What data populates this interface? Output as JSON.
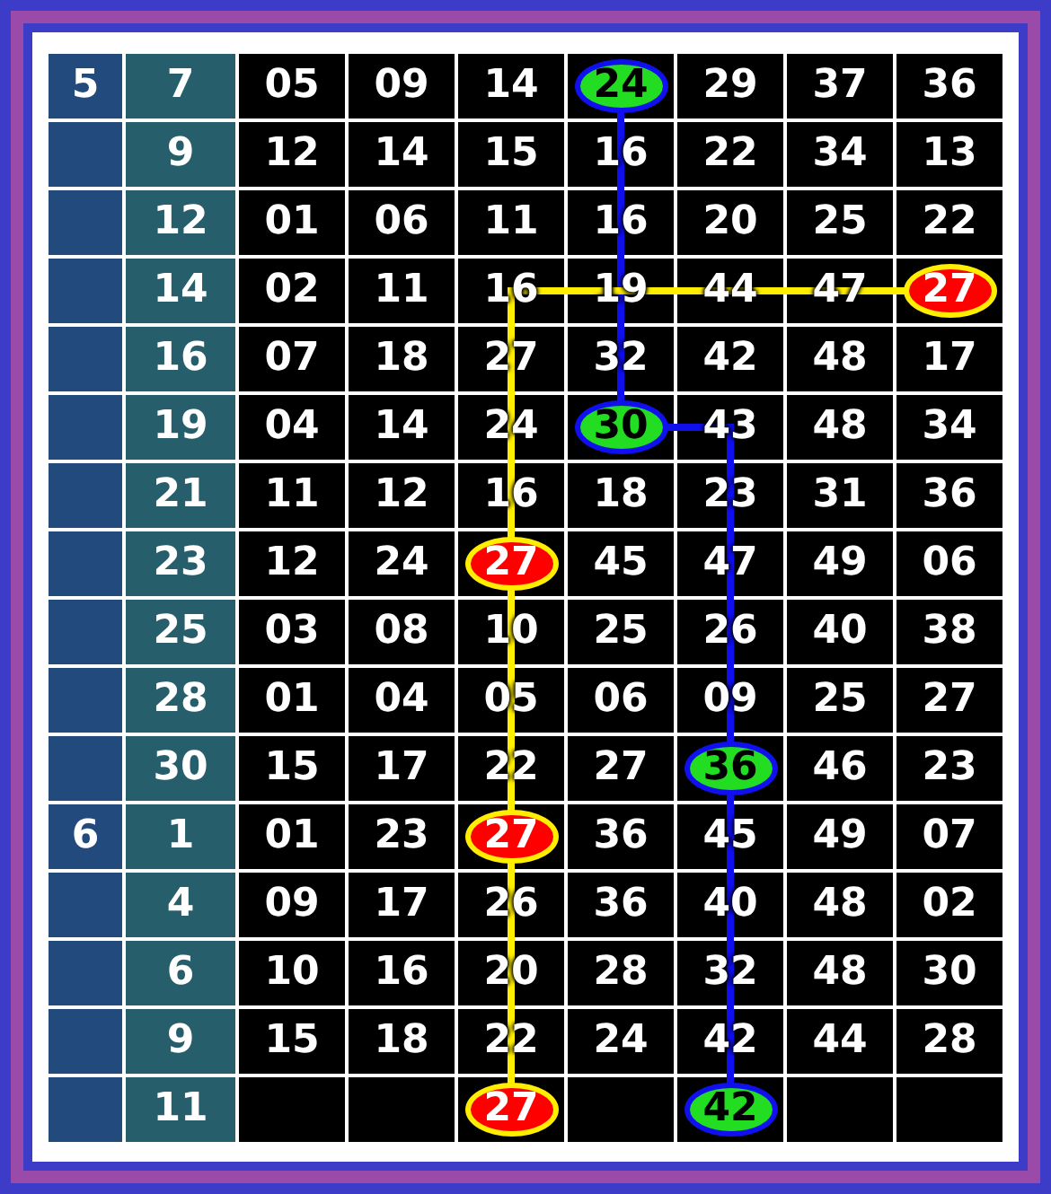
{
  "rows": [
    {
      "month": "5",
      "day": "7",
      "cells": [
        {
          "text": "05"
        },
        {
          "text": "09"
        },
        {
          "text": "14"
        },
        {
          "text": "24",
          "color": "#22dd22"
        },
        {
          "text": "29"
        },
        {
          "text": "37"
        },
        {
          "text": "36"
        }
      ]
    },
    {
      "day": "9",
      "cells": [
        {
          "text": "12"
        },
        {
          "text": "14"
        },
        {
          "text": "15"
        },
        {
          "text": "16"
        },
        {
          "text": "22"
        },
        {
          "text": "34"
        },
        {
          "text": "13"
        }
      ]
    },
    {
      "day": "12",
      "cells": [
        {
          "text": "01"
        },
        {
          "text": "06"
        },
        {
          "text": "11"
        },
        {
          "text": "16"
        },
        {
          "text": "20"
        },
        {
          "text": "25"
        },
        {
          "text": "22"
        }
      ]
    },
    {
      "day": "14",
      "cells": [
        {
          "text": "02"
        },
        {
          "text": "11"
        },
        {
          "text": "16"
        },
        {
          "text": "19"
        },
        {
          "text": "44"
        },
        {
          "text": "47"
        },
        {
          "text": "27",
          "color": "#ff0000"
        }
      ]
    },
    {
      "day": "16",
      "cells": [
        {
          "text": "07"
        },
        {
          "text": "18"
        },
        {
          "text": "27"
        },
        {
          "text": "32"
        },
        {
          "text": "42"
        },
        {
          "text": "48"
        },
        {
          "text": "17"
        }
      ]
    },
    {
      "day": "19",
      "cells": [
        {
          "text": "04"
        },
        {
          "text": "14"
        },
        {
          "text": "24"
        },
        {
          "text": "30",
          "color": "#22dd22"
        },
        {
          "text": "43"
        },
        {
          "text": "48"
        },
        {
          "text": "34"
        }
      ]
    },
    {
      "day": "21",
      "cells": [
        {
          "text": "11"
        },
        {
          "text": "12"
        },
        {
          "text": "16"
        },
        {
          "text": "18"
        },
        {
          "text": "23"
        },
        {
          "text": "31"
        },
        {
          "text": "36"
        }
      ]
    },
    {
      "day": "23",
      "cells": [
        {
          "text": "12"
        },
        {
          "text": "24"
        },
        {
          "text": "27",
          "color": "#ff0000"
        },
        {
          "text": "45"
        },
        {
          "text": "47"
        },
        {
          "text": "49"
        },
        {
          "text": "06"
        }
      ]
    },
    {
      "day": "25",
      "cells": [
        {
          "text": "03"
        },
        {
          "text": "08"
        },
        {
          "text": "10"
        },
        {
          "text": "25"
        },
        {
          "text": "26"
        },
        {
          "text": "40"
        },
        {
          "text": "38"
        }
      ]
    },
    {
      "day": "28",
      "cells": [
        {
          "text": "01"
        },
        {
          "text": "04"
        },
        {
          "text": "05"
        },
        {
          "text": "06"
        },
        {
          "text": "09"
        },
        {
          "text": "25"
        },
        {
          "text": "27"
        }
      ]
    },
    {
      "day": "30",
      "cells": [
        {
          "text": "15"
        },
        {
          "text": "17"
        },
        {
          "text": "22"
        },
        {
          "text": "27"
        },
        {
          "text": "36",
          "color": "#22dd22"
        },
        {
          "text": "46"
        },
        {
          "text": "23"
        }
      ]
    },
    {
      "month": "6",
      "day": "1",
      "cells": [
        {
          "text": "01"
        },
        {
          "text": "23"
        },
        {
          "text": "27",
          "color": "#ff0000"
        },
        {
          "text": "36"
        },
        {
          "text": "45"
        },
        {
          "text": "49"
        },
        {
          "text": "07"
        }
      ]
    },
    {
      "day": "4",
      "cells": [
        {
          "text": "09"
        },
        {
          "text": "17"
        },
        {
          "text": "26"
        },
        {
          "text": "36"
        },
        {
          "text": "40"
        },
        {
          "text": "48"
        },
        {
          "text": "02"
        }
      ]
    },
    {
      "day": "6",
      "cells": [
        {
          "text": "10"
        },
        {
          "text": "16"
        },
        {
          "text": "20"
        },
        {
          "text": "28"
        },
        {
          "text": "32"
        },
        {
          "text": "48"
        },
        {
          "text": "30"
        }
      ]
    },
    {
      "day": "9",
      "cells": [
        {
          "text": "15"
        },
        {
          "text": "18"
        },
        {
          "text": "22"
        },
        {
          "text": "24"
        },
        {
          "text": "42"
        },
        {
          "text": "44"
        },
        {
          "text": "28"
        }
      ]
    },
    {
      "day": "11",
      "cells": [
        null,
        null,
        {
          "text": "27",
          "color": "#ff0000"
        },
        null,
        {
          "text": "42",
          "color": "#22dd22"
        },
        null,
        null
      ]
    }
  ]
}
